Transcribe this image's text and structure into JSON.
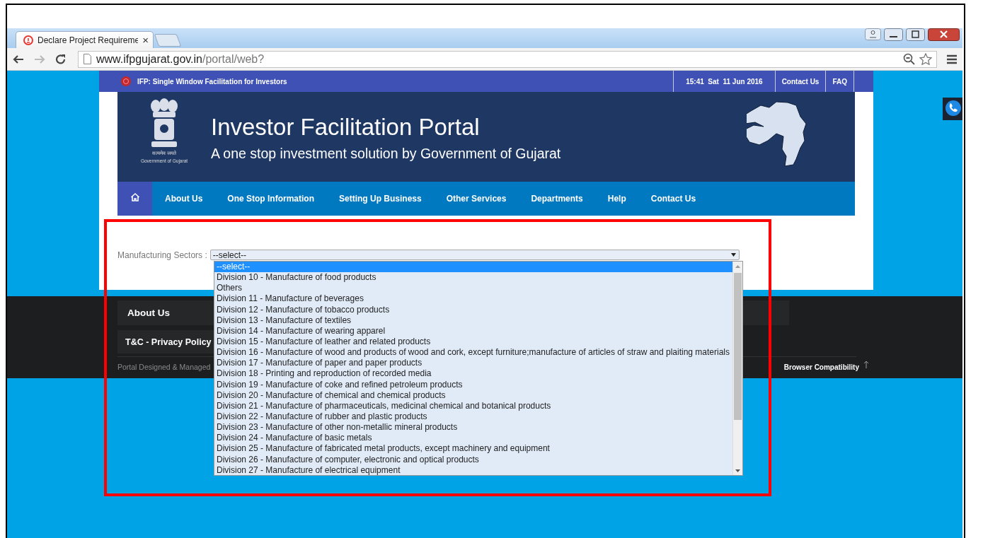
{
  "browser": {
    "tab": {
      "title": "Declare Project Requireme",
      "close": "×"
    },
    "url": {
      "host": "www.ifpgujarat.gov.in",
      "path": "/portal/web?"
    }
  },
  "topbar": {
    "title": "IFP: Single Window Facilitation for Investors",
    "datetime": "15:41  Sat  11 Jun 2016",
    "links": [
      "Contact Us",
      "FAQ"
    ]
  },
  "banner": {
    "motto": "सत्यमेव जयते",
    "emblem_caption": "Government of Gujarat",
    "title": "Investor Facilitation Portal",
    "subtitle": "A one stop investment solution by Government of Gujarat"
  },
  "nav": {
    "items": [
      "About Us",
      "One Stop Information",
      "Setting Up Business",
      "Other Services",
      "Departments",
      "Help",
      "Contact Us"
    ]
  },
  "sectors": {
    "label": "Manufacturing Sectors :",
    "value": "--select--",
    "options": [
      {
        "label": "--select--",
        "selected": true
      },
      {
        "label": "Division 10 - Manufacture of food products",
        "selected": false
      },
      {
        "label": "Others",
        "selected": false
      },
      {
        "label": "Division 11 - Manufacture of beverages",
        "selected": false
      },
      {
        "label": "Division 12 - Manufacture of tobacco products",
        "selected": false
      },
      {
        "label": "Division 13 - Manufacture of textiles",
        "selected": false
      },
      {
        "label": "Division 14 - Manufacture of wearing apparel",
        "selected": false
      },
      {
        "label": "Division 15 - Manufacture of leather and related products",
        "selected": false
      },
      {
        "label": "Division 16 - Manufacture of wood and products of wood and cork, except furniture;manufacture of articles of straw and plaiting materials",
        "selected": false
      },
      {
        "label": "Division 17 - Manufacture of paper and paper products",
        "selected": false
      },
      {
        "label": "Division 18 - Printing and reproduction of recorded media",
        "selected": false
      },
      {
        "label": "Division 19 - Manufacture of coke and refined petroleum products",
        "selected": false
      },
      {
        "label": "Division 20 - Manufacture of chemical and chemical products",
        "selected": false
      },
      {
        "label": "Division 21 - Manufacture of pharmaceuticals, medicinal chemical and botanical products",
        "selected": false
      },
      {
        "label": "Division 22 - Manufacture of rubber and plastic products",
        "selected": false
      },
      {
        "label": "Division 23 - Manufacture of other non-metallic mineral products",
        "selected": false
      },
      {
        "label": "Division 24 - Manufacture of basic metals",
        "selected": false
      },
      {
        "label": "Division 25 - Manufacture of fabricated metal products, except machinery and equipment",
        "selected": false
      },
      {
        "label": "Division 26 - Manufacture of computer, electronic and optical products",
        "selected": false
      },
      {
        "label": "Division 27 - Manufacture of electrical equipment",
        "selected": false
      }
    ]
  },
  "footer": {
    "sections": [
      "About Us",
      "T&C - Privacy Policy"
    ],
    "credit": "Portal Designed & Managed",
    "compat": "Browser Compatibility"
  }
}
